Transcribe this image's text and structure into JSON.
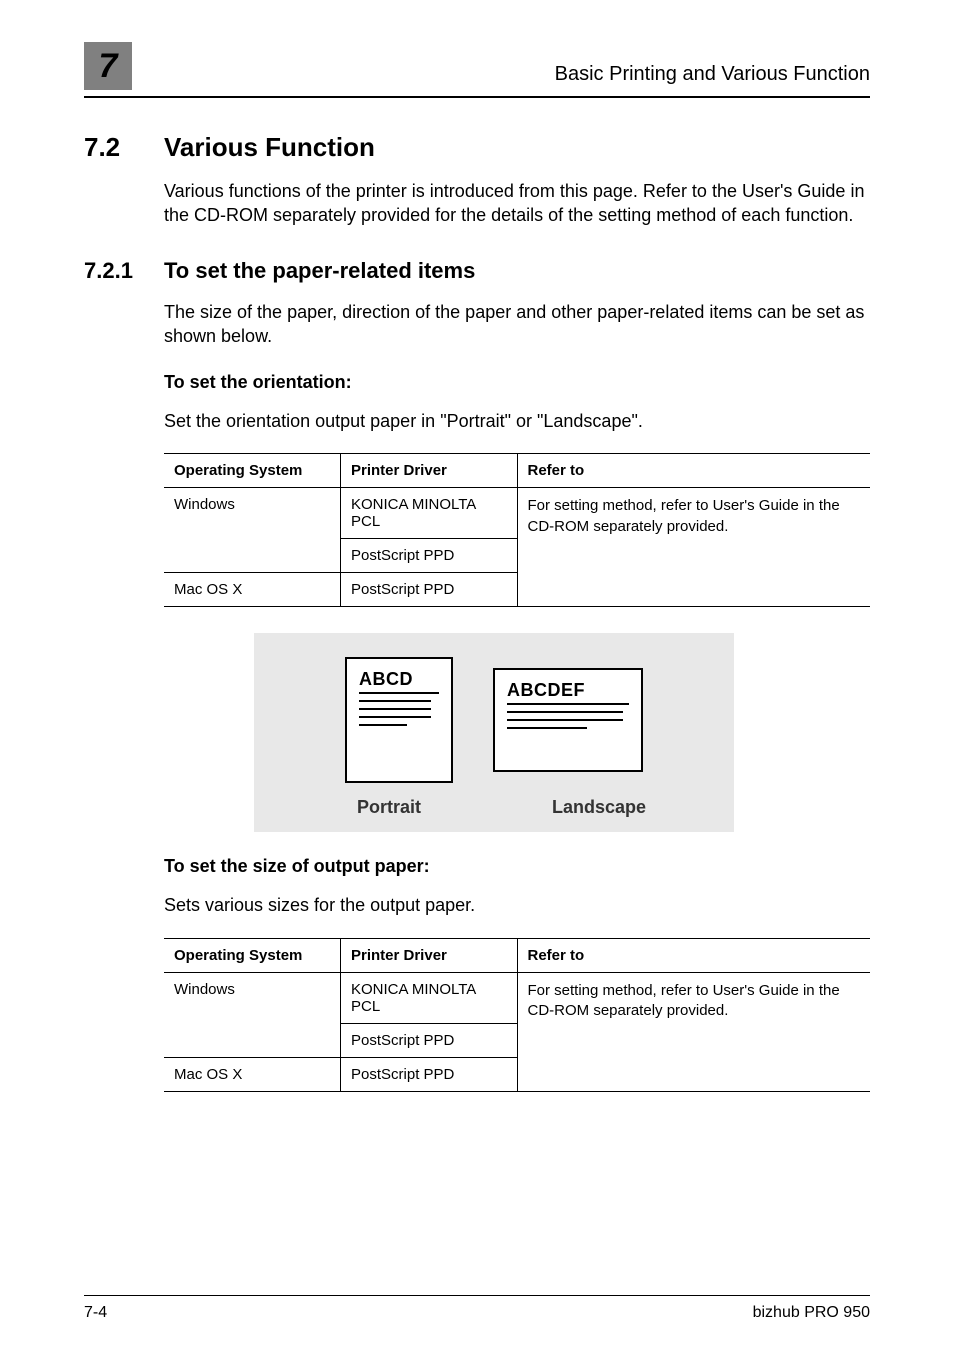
{
  "header": {
    "chapter_number": "7",
    "title": "Basic Printing and Various Function"
  },
  "section": {
    "number": "7.2",
    "title": "Various Function",
    "intro": "Various functions of the printer is introduced from this page. Refer to the User's Guide in the CD-ROM separately provided for the details of the setting method of each function."
  },
  "subsection": {
    "number": "7.2.1",
    "title": "To set the paper-related items",
    "intro": "The size of the paper, direction of the paper and other paper-related items can be set as shown below."
  },
  "orientation": {
    "heading": "To set the orientation:",
    "text": "Set the orientation output paper in \"Portrait\" or \"Landscape\".",
    "table": {
      "headers": {
        "os": "Operating System",
        "driver": "Printer Driver",
        "refer": "Refer to"
      },
      "rows": {
        "r0_os": "Windows",
        "r0_driver": "KONICA MINOLTA PCL",
        "r1_driver": "PostScript PPD",
        "r2_os": "Mac OS X",
        "r2_driver": "PostScript PPD",
        "refer_text": "For setting method, refer to User's Guide in the CD-ROM separately provided."
      }
    },
    "diagram": {
      "portrait_label": "ABCD",
      "landscape_label": "ABCDEF",
      "portrait_caption": "Portrait",
      "landscape_caption": "Landscape"
    }
  },
  "output_paper": {
    "heading": "To set the size of output paper:",
    "text": "Sets various sizes for the output paper.",
    "table": {
      "headers": {
        "os": "Operating System",
        "driver": "Printer Driver",
        "refer": "Refer to"
      },
      "rows": {
        "r0_os": "Windows",
        "r0_driver": "KONICA MINOLTA PCL",
        "r1_driver": "PostScript PPD",
        "r2_os": "Mac OS X",
        "r2_driver": "PostScript PPD",
        "refer_text": "For setting method, refer to User's Guide in the CD-ROM separately provided."
      }
    }
  },
  "footer": {
    "page_number": "7-4",
    "product": "bizhub PRO 950"
  }
}
